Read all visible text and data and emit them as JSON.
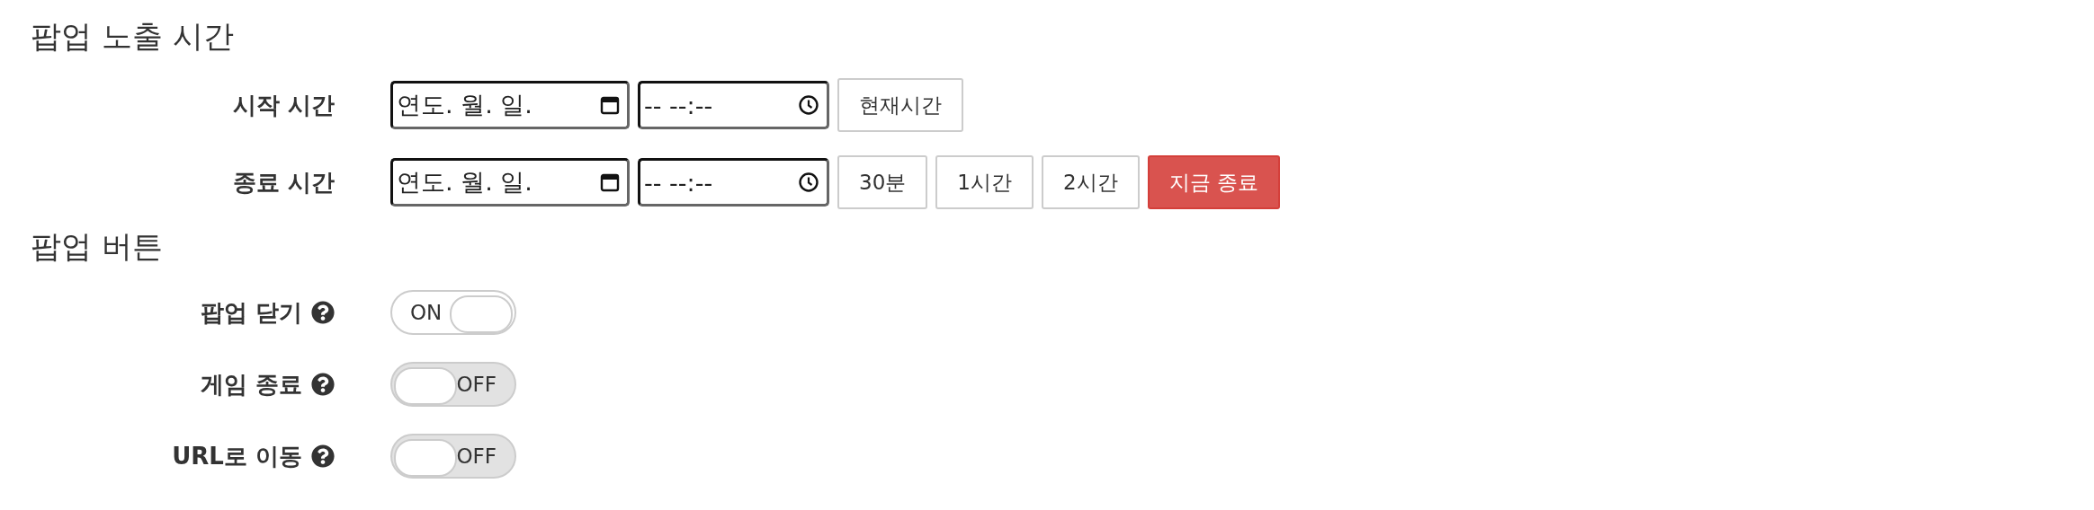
{
  "sections": [
    {
      "title": "팝업 노출 시간",
      "rows": [
        {
          "kind": "datetime",
          "label": "시작 시간",
          "date": {
            "placeholder": "연도. 월. 일."
          },
          "time": {
            "placeholder": "-- --:--"
          },
          "buttons": [
            {
              "label": "현재시간",
              "kind": "default"
            }
          ]
        },
        {
          "kind": "datetime",
          "label": "종료 시간",
          "date": {
            "placeholder": "연도. 월. 일."
          },
          "time": {
            "placeholder": "-- --:--"
          },
          "buttons": [
            {
              "label": "30분",
              "kind": "default"
            },
            {
              "label": "1시간",
              "kind": "default"
            },
            {
              "label": "2시간",
              "kind": "default"
            },
            {
              "label": "지금 종료",
              "kind": "danger"
            }
          ]
        }
      ]
    },
    {
      "title": "팝업 버튼",
      "rows": [
        {
          "kind": "toggle",
          "label": "팝업 닫기",
          "on": true,
          "state_text": "ON"
        },
        {
          "kind": "toggle",
          "label": "게임 종료",
          "on": false,
          "state_text": "OFF"
        },
        {
          "kind": "toggle",
          "label": "URL로 이동",
          "on": false,
          "state_text": "OFF"
        }
      ]
    }
  ]
}
